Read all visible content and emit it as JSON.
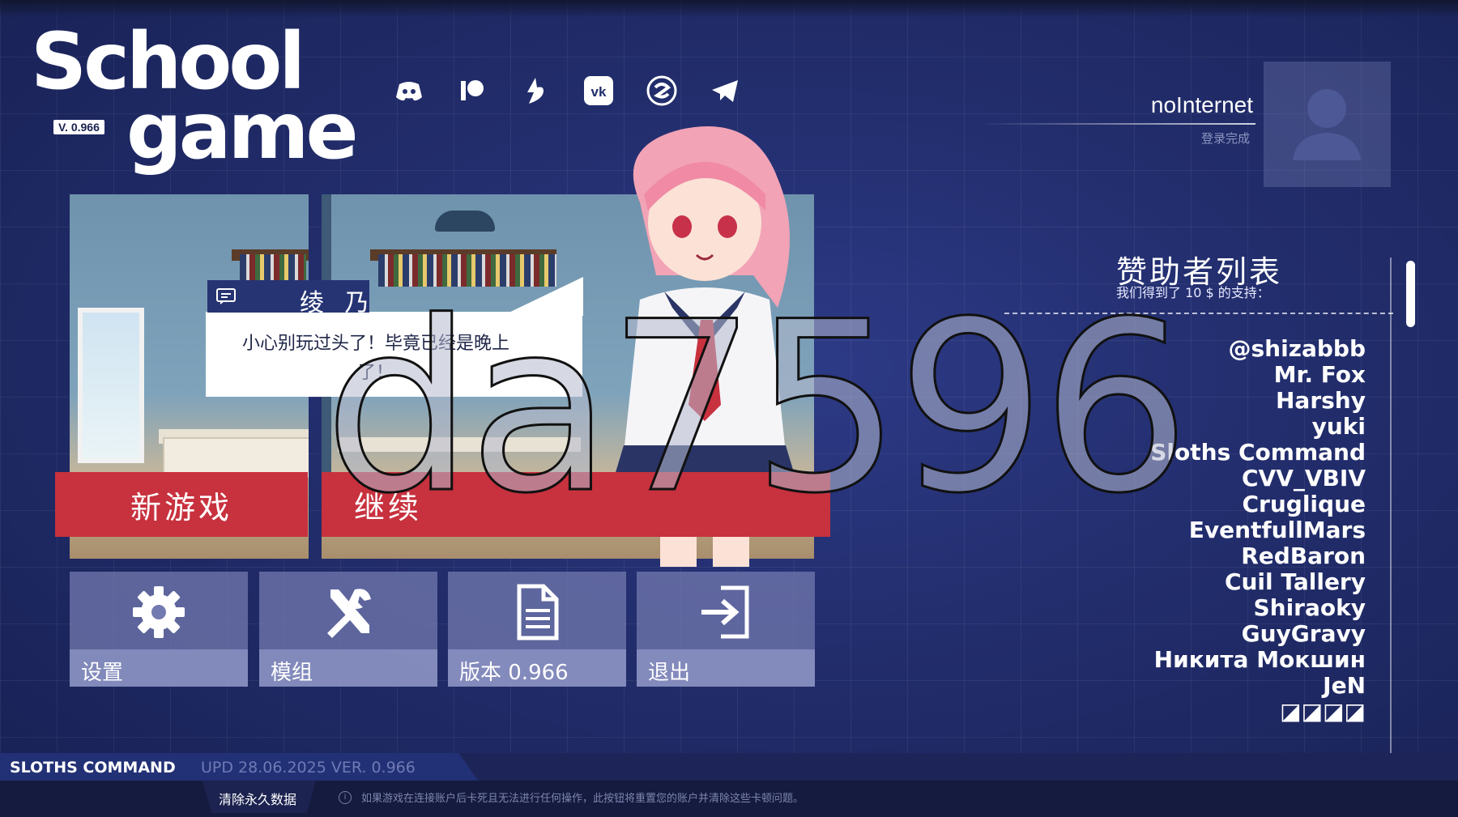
{
  "app": {
    "logo_line1": "School",
    "logo_line2": "game",
    "version_badge": "V. 0.966"
  },
  "socials": [
    {
      "icon": "discord-icon"
    },
    {
      "icon": "patreon-icon"
    },
    {
      "icon": "boosty-icon"
    },
    {
      "icon": "vk-icon"
    },
    {
      "icon": "subscribestar-icon"
    },
    {
      "icon": "telegram-icon"
    }
  ],
  "user": {
    "name": "noInternet",
    "status": "登录完成"
  },
  "dialogue": {
    "speaker": "绫 乃",
    "text": "小心别玩过头了！毕竟已经是晚上了！"
  },
  "main_buttons": {
    "new_game": "新游戏",
    "continue": "继续"
  },
  "tiles": {
    "settings": "设置",
    "mods": "模组",
    "version": "版本 0.966",
    "exit": "退出"
  },
  "sponsors": {
    "title": "赞助者列表",
    "subtitle": "我们得到了 10 $ 的支持：",
    "names": [
      "@shizabbb",
      "Mr. Fox",
      "Harshy",
      "yuki",
      "Sloths Command",
      "CVV_VBIV",
      "Cruglique",
      "EventfullMars",
      "RedBaron",
      "Cuil Tallery",
      "Shiraoky",
      "GuyGravy",
      "Никита Мокшин",
      "JeN",
      "◪◪◪◪"
    ]
  },
  "watermark": "da7596",
  "footer": {
    "studio": "SLOTHS COMMAND",
    "update": "UPD 28.06.2025 VER. 0.966",
    "clear_data": "清除永久数据",
    "info_text": "如果游戏在连接账户后卡死且无法进行任何操作，此按钮将重置您的账户并清除这些卡顿问题。"
  },
  "colors": {
    "background": "#222d6c",
    "accent_red": "#c8313e",
    "tile": "#737aaf"
  }
}
